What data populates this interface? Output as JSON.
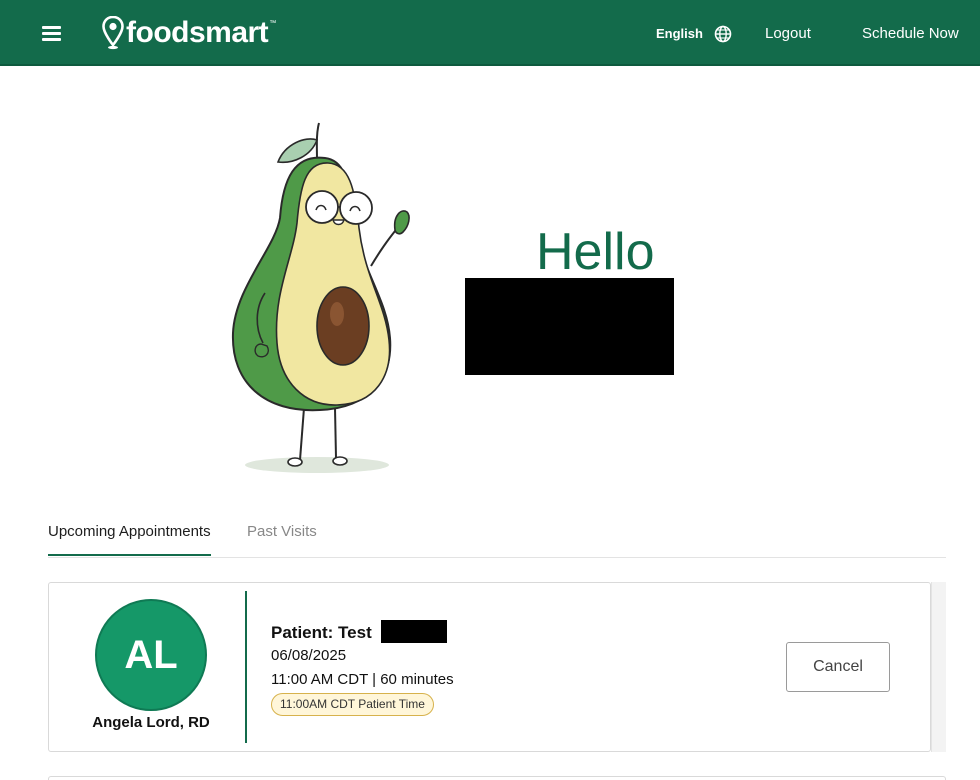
{
  "header": {
    "brand": "foodsmart",
    "brand_mark": "™",
    "language": "English",
    "logout": "Logout",
    "schedule": "Schedule Now",
    "bg_color": "#136b4b"
  },
  "hero": {
    "greeting": "Hello"
  },
  "tabs": [
    {
      "label": "Upcoming Appointments",
      "active": true
    },
    {
      "label": "Past Visits",
      "active": false
    }
  ],
  "appointment": {
    "initials": "AL",
    "provider": "Angela Lord, RD",
    "patient_label": "Patient: Test",
    "date": "06/08/2025",
    "time": "11:00 AM CDT | 60 minutes",
    "patient_time": "11:00AM CDT Patient Time",
    "cancel": "Cancel",
    "avatar_color": "#159868",
    "badge_color": "#fff6d9"
  },
  "icons": {
    "menu": "hamburger-icon",
    "logo": "map-pin-icon",
    "language": "globe-icon"
  }
}
